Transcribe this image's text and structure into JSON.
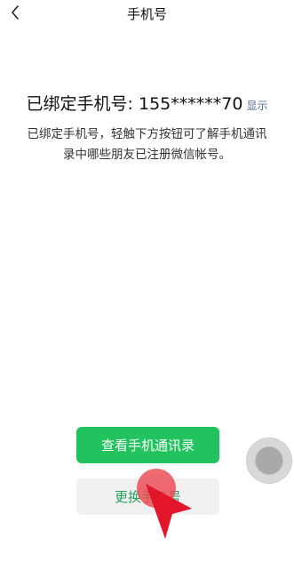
{
  "header": {
    "title": "手机号",
    "back_icon": "chevron-left-icon"
  },
  "bound": {
    "text": "已绑定手机号: 155******70",
    "show_label": "显示"
  },
  "description": "已绑定手机号，轻触下方按钮可了解手机通讯录中哪些朋友已注册微信帐号。",
  "buttons": {
    "view_contacts": "查看手机通讯录",
    "change_number": "更换手机号"
  },
  "colors": {
    "primary_green": "#22c35e",
    "link_blue": "#576b95",
    "secondary_bg": "#f1f1f1",
    "touch_indicator": "#ec4852"
  },
  "overlays": {
    "assistive_touch_icon": "assistive-touch-icon",
    "pointer_icon": "red-arrow-pointer-icon"
  }
}
